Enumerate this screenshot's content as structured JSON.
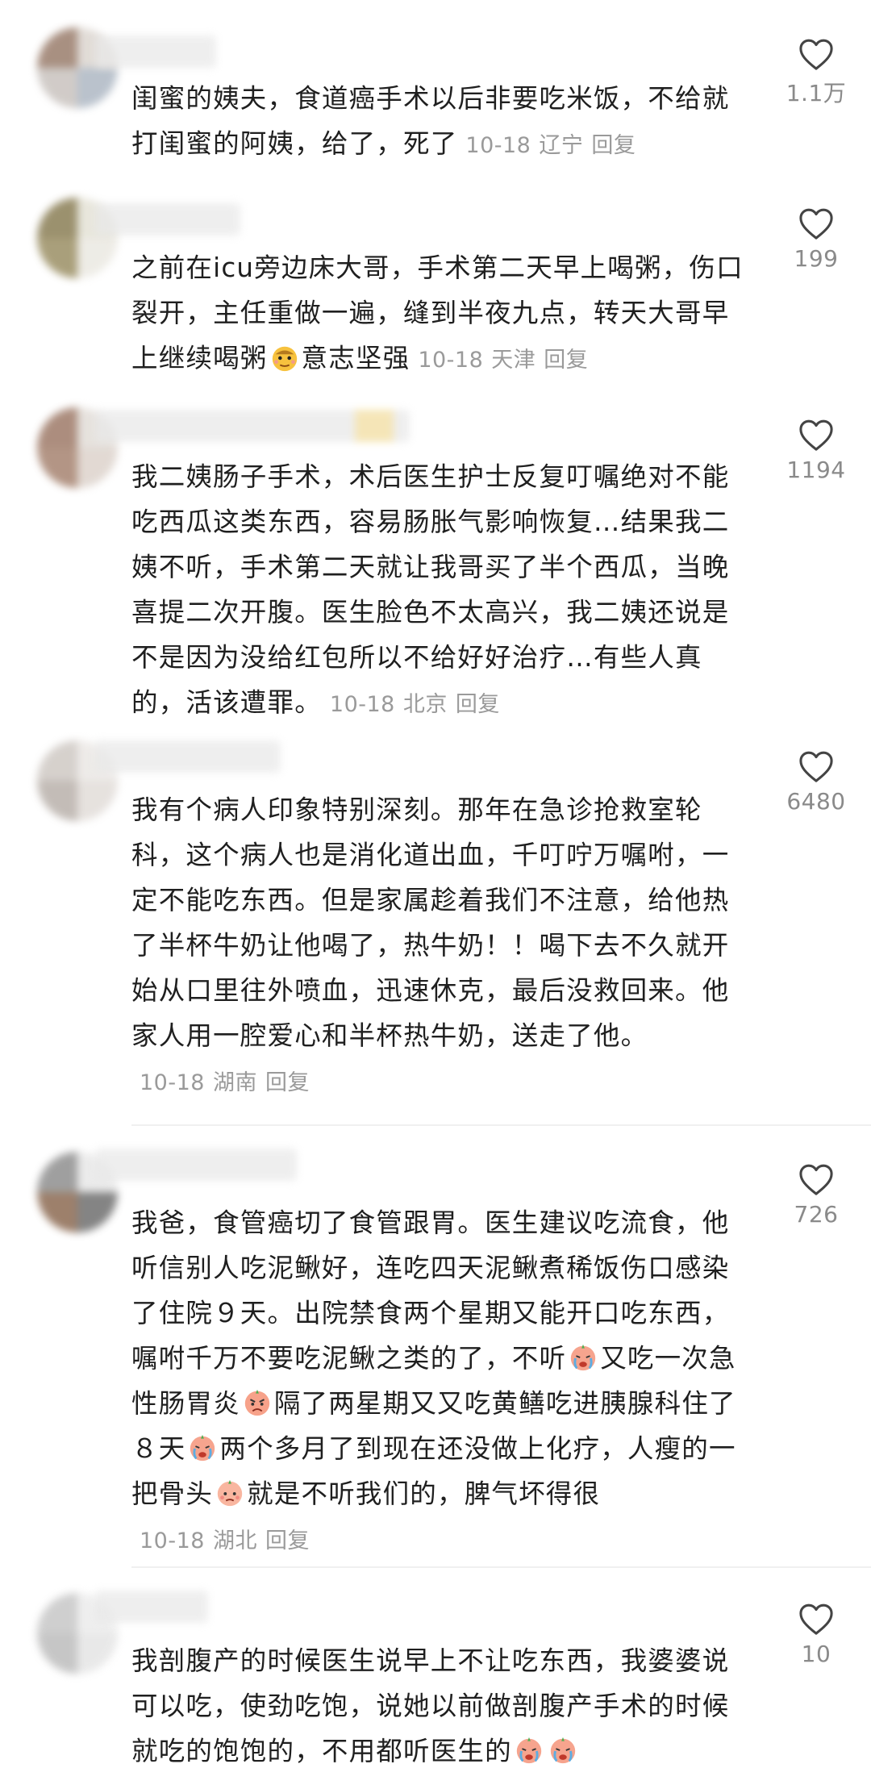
{
  "comments": [
    {
      "text": "闺蜜的姨夫，食道癌手术以后非要吃米饭，不给就打闺蜜的阿姨，给了，死了",
      "date": "10-18",
      "region": "辽宁",
      "reply_label": "回复",
      "likes": "1.1万"
    },
    {
      "text_before": "之前在icu旁边床大哥，手术第二天早上喝粥，伤口裂开，主任重做一遍，缝到半夜九点，转天大哥早上继续喝粥",
      "emoji": "proud-face-emoji",
      "text_after": "意志坚强",
      "date": "10-18",
      "region": "天津",
      "reply_label": "回复",
      "likes": "199"
    },
    {
      "text": "我二姨肠子手术，术后医生护士反复叮嘱绝对不能吃西瓜这类东西，容易肠胀气影响恢复…结果我二姨不听，手术第二天就让我哥买了半个西瓜，当晚喜提二次开腹。医生脸色不太高兴，我二姨还说是不是因为没给红包所以不给好好治疗…有些人真的，活该遭罪。",
      "date": "10-18",
      "region": "北京",
      "reply_label": "回复",
      "likes": "1194"
    },
    {
      "text": "我有个病人印象特别深刻。那年在急诊抢救室轮科，这个病人也是消化道出血，千叮咛万嘱咐，一定不能吃东西。但是家属趁着我们不注意，给他热了半杯牛奶让他喝了，热牛奶！！喝下去不久就开始从口里往外喷血，迅速休克，最后没救回来。他家人用一腔爱心和半杯热牛奶，送走了他。",
      "date": "10-18",
      "region": "湖南",
      "reply_label": "回复",
      "likes": "6480"
    },
    {
      "text_1": "我爸，食管癌切了食管跟胃。医生建议吃流食，他听信别人吃泥鳅好，连吃四天泥鳅煮稀饭伤口感染了住院９天。出院禁食两个星期又能开口吃东西，嘱咐千万不要吃泥鳅之类的了，不听",
      "emoji_1": "crying-face-emoji",
      "text_2": "又吃一次急性肠胃炎",
      "emoji_2": "angry-face-emoji",
      "text_3": "隔了两星期又又吃黄鳝吃进胰腺科住了８天",
      "emoji_3": "crying-face-emoji",
      "text_4": "两个多月了到现在还没做上化疗，人瘦的一把骨头",
      "emoji_4": "sad-face-emoji",
      "text_5": "就是不听我们的，脾气坏得很",
      "date": "10-18",
      "region": "湖北",
      "reply_label": "回复",
      "likes": "726"
    },
    {
      "text": "我剖腹产的时候医生说早上不让吃东西，我婆婆说可以吃，使劲吃饱，说她以前做剖腹产手术的时候就吃的饱饱的，不用都听医生的",
      "emoji_1": "crying-face-emoji",
      "emoji_2": "crying-face-emoji",
      "likes": "10"
    }
  ],
  "colors": {
    "text": "#1f1f1f",
    "meta": "#9a9a9a",
    "count": "#8a8a8a",
    "heart_stroke": "#444444",
    "divider": "#f0f0f0"
  }
}
